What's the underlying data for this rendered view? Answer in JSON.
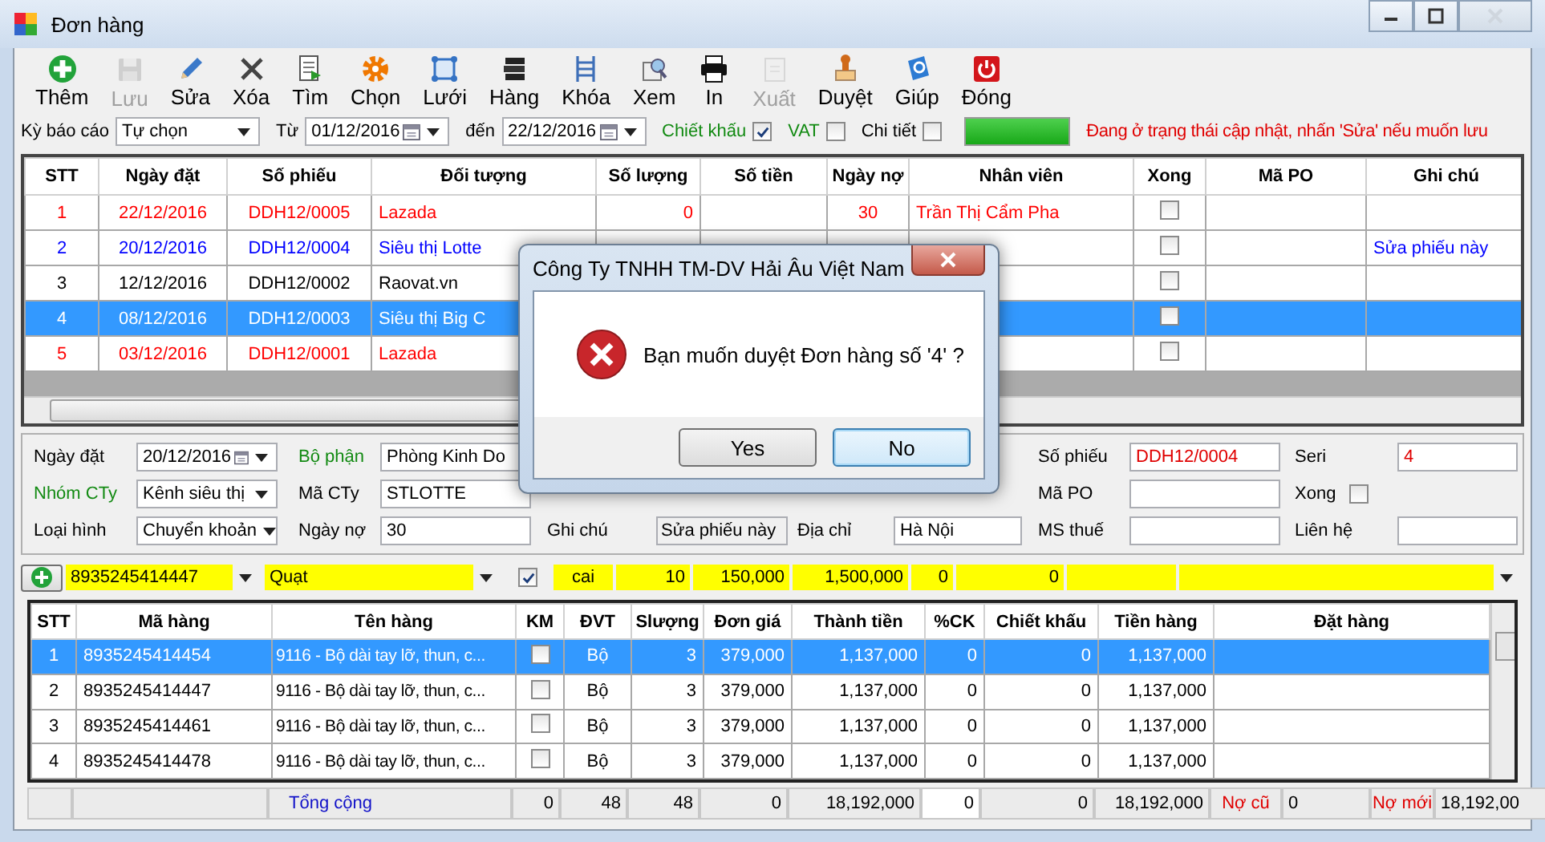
{
  "window": {
    "title": "Đơn hàng"
  },
  "toolbar": [
    {
      "label": "Thêm",
      "disabled": false
    },
    {
      "label": "Lưu",
      "disabled": true
    },
    {
      "label": "Sửa",
      "disabled": false
    },
    {
      "label": "Xóa",
      "disabled": false
    },
    {
      "label": "Tìm",
      "disabled": false
    },
    {
      "label": "Chọn",
      "disabled": false
    },
    {
      "label": "Lưới",
      "disabled": false
    },
    {
      "label": "Hàng",
      "disabled": false
    },
    {
      "label": "Khóa",
      "disabled": false
    },
    {
      "label": "Xem",
      "disabled": false
    },
    {
      "label": "In",
      "disabled": false
    },
    {
      "label": "Xuất",
      "disabled": true
    },
    {
      "label": "Duyệt",
      "disabled": false
    },
    {
      "label": "Giúp",
      "disabled": false
    },
    {
      "label": "Đóng",
      "disabled": false
    }
  ],
  "filter": {
    "period_label": "Kỳ báo cáo",
    "period": "Tự chọn",
    "from_label": "Từ",
    "from": "01/12/2016",
    "to_label": "đến",
    "to": "22/12/2016",
    "options": [
      {
        "label": "Chiết khấu",
        "checked": true
      },
      {
        "label": "VAT",
        "checked": false
      },
      {
        "label": "Chi tiết",
        "checked": false
      }
    ],
    "progress": {
      "level": 1
    },
    "status": "Đang ở trạng thái cập nhật, nhấn 'Sửa' nếu muốn lưu"
  },
  "orders": {
    "columns": [
      "STT",
      "Ngày đặt",
      "Số phiếu",
      "Đối tượng",
      "Số lượng",
      "Số tiền",
      "Ngày nợ",
      "Nhân viên",
      "Xong",
      "Mã PO",
      "Ghi chú"
    ],
    "rows": [
      {
        "stt": "1",
        "date": "22/12/2016",
        "number": "DDH12/0005",
        "customer": "Lazada",
        "qty": "0",
        "days": "30",
        "staff": "Trần Thị Cẩm Pha",
        "done": false,
        "selected": false,
        "color": "#ff0000"
      },
      {
        "stt": "2",
        "date": "20/12/2016",
        "number": "DDH12/0004",
        "customer": "Siêu thị Lotte",
        "note": "Sửa phiếu này",
        "done": false,
        "selected": false,
        "color": "#0000ff"
      },
      {
        "stt": "3",
        "date": "12/12/2016",
        "number": "DDH12/0002",
        "customer": "Raovat.vn",
        "done": false,
        "selected": false,
        "color": "#000000"
      },
      {
        "stt": "4",
        "date": "08/12/2016",
        "number": "DDH12/0003",
        "customer": "Siêu thị Big C",
        "done": false,
        "selected": true
      },
      {
        "stt": "5",
        "date": "03/12/2016",
        "number": "DDH12/0001",
        "customer": "Lazada",
        "done": false,
        "selected": false,
        "color": "#ff0000"
      }
    ]
  },
  "form": {
    "order_date_label": "Ngày đặt",
    "order_date": "20/12/2016",
    "department_label": "Bộ phận",
    "department": "Phòng Kinh Do",
    "number_label": "Số phiếu",
    "number": "DDH12/0004",
    "serial_label": "Seri",
    "serial": "4",
    "group_label": "Nhóm CTy",
    "group": "Kênh siêu thị",
    "company_label": "Mã CTy",
    "company": "STLOTTE",
    "po_label": "Mã PO",
    "done_label": "Xong",
    "done": false,
    "type_label": "Loại hình",
    "type": "Chuyển khoản",
    "days_label": "Ngày nợ",
    "days": "30",
    "note_label": "Ghi chú",
    "note": "Sửa phiếu này",
    "address_label": "Địa chỉ",
    "address": "Hà Nội",
    "tax_label": "MS thuế",
    "contact_label": "Liên hệ"
  },
  "entry": {
    "code": "8935245414447",
    "name": "Quạt",
    "promo": true,
    "unit": "cai",
    "qty": "10",
    "price": "150,000",
    "total": "1,500,000",
    "pct": "0",
    "discount": "0"
  },
  "items": {
    "columns": [
      "STT",
      "Mã hàng",
      "Tên hàng",
      "KM",
      "ĐVT",
      "Slượng",
      "Đơn giá",
      "Thành tiền",
      "%CK",
      "Chiết khấu",
      "Tiền hàng",
      "Đặt hàng"
    ],
    "rows": [
      {
        "stt": "1",
        "code": "8935245414454",
        "name": "9116 - Bộ dài tay lỡ, thun, c...",
        "promo": false,
        "unit": "Bộ",
        "qty": "3",
        "price": "379,000",
        "total": "1,137,000",
        "pct": "0",
        "discount": "0",
        "net": "1,137,000",
        "selected": true
      },
      {
        "stt": "2",
        "code": "8935245414447",
        "name": "9116 - Bộ dài tay lỡ, thun, c...",
        "promo": false,
        "unit": "Bộ",
        "qty": "3",
        "price": "379,000",
        "total": "1,137,000",
        "pct": "0",
        "discount": "0",
        "net": "1,137,000",
        "selected": false
      },
      {
        "stt": "3",
        "code": "8935245414461",
        "name": "9116 - Bộ dài tay lỡ, thun, c...",
        "promo": false,
        "unit": "Bộ",
        "qty": "3",
        "price": "379,000",
        "total": "1,137,000",
        "pct": "0",
        "discount": "0",
        "net": "1,137,000",
        "selected": false
      },
      {
        "stt": "4",
        "code": "8935245414478",
        "name": "9116 - Bộ dài tay lỡ, thun, c...",
        "promo": false,
        "unit": "Bộ",
        "qty": "3",
        "price": "379,000",
        "total": "1,137,000",
        "pct": "0",
        "discount": "0",
        "net": "1,137,000",
        "selected": false
      }
    ]
  },
  "totals": {
    "label": "Tổng cộng",
    "promo": "0",
    "unit": "48",
    "qty": "48",
    "price": "0",
    "total": "18,192,000",
    "pct": "0",
    "discount": "0",
    "net": "18,192,000",
    "old_debt_label": "Nợ cũ",
    "old_debt": "0",
    "new_debt_label": "Nợ mới",
    "new_debt": "18,192,00"
  },
  "dialog": {
    "title": "Công Ty TNHH TM-DV Hải Âu Việt Nam",
    "message": "Bạn muốn duyệt Đơn hàng số '4' ?",
    "buttons": [
      {
        "label": "Yes",
        "selected": false
      },
      {
        "label": "No",
        "selected": true
      }
    ]
  }
}
